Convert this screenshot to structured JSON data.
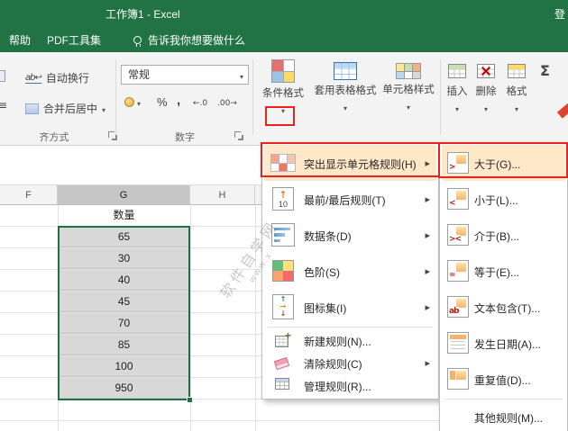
{
  "titlebar": {
    "title": "工作簿1 - Excel",
    "signin_label": "登"
  },
  "menubar": {
    "tabs": [
      {
        "label": "帮助"
      },
      {
        "label": "PDF工具集"
      }
    ],
    "tell_me": "告诉我你想要做什么"
  },
  "ribbon": {
    "wrap_text_label": "自动换行",
    "merge_center_label": "合并后居中",
    "number_format_value": "常规",
    "percent_label": "%",
    "comma_label": ",",
    "increase_decimal_label": "←.0",
    "decrease_decimal_label": ".00→",
    "conditional_formatting_label": "条件格式",
    "format_as_table_label": "套用表格格式",
    "cell_styles_label": "单元格样式",
    "insert_label": "插入",
    "delete_label": "删除",
    "format_label": "格式",
    "autosum_label": "Σ",
    "alignment_group_label": "齐方式",
    "number_group_label": "数字"
  },
  "sheet": {
    "column_headers": [
      "F",
      "G",
      "H"
    ],
    "selected_column": "G",
    "header_cell": "数量",
    "values": [
      "65",
      "30",
      "40",
      "45",
      "70",
      "85",
      "100",
      "950"
    ]
  },
  "cf_menu": {
    "items": [
      {
        "label": "突出显示单元格规则(H)",
        "has_submenu": true,
        "highlighted": true
      },
      {
        "label": "最前/最后规则(T)",
        "has_submenu": true
      },
      {
        "label": "数据条(D)",
        "has_submenu": true
      },
      {
        "label": "色阶(S)",
        "has_submenu": true
      },
      {
        "label": "图标集(I)",
        "has_submenu": true
      },
      {
        "label": "新建规则(N)...",
        "has_submenu": false
      },
      {
        "label": "清除规则(C)",
        "has_submenu": true
      },
      {
        "label": "管理规则(R)...",
        "has_submenu": false
      }
    ]
  },
  "cf_submenu": {
    "items": [
      {
        "label": "大于(G)...",
        "symbol": ">",
        "highlighted": true
      },
      {
        "label": "小于(L)...",
        "symbol": "<"
      },
      {
        "label": "介于(B)...",
        "symbol": "><"
      },
      {
        "label": "等于(E)...",
        "symbol": "="
      },
      {
        "label": "文本包含(T)...",
        "symbol": "ab"
      },
      {
        "label": "发生日期(A)...",
        "symbol": ""
      },
      {
        "label": "重复值(D)...",
        "symbol": ""
      },
      {
        "label": "其他规则(M)...",
        "symbol": ""
      }
    ]
  },
  "icons": {
    "lightbulb_icon": "lightbulb outline",
    "dropdown_caret": "▾",
    "submenu_arrow": "▸",
    "wrap_text_icon": "ab↩",
    "merge_center_icon": "merged-cell",
    "currency_icon": "coin",
    "conditional_formatting_icon": "colored-grid",
    "format_as_table_icon": "blue-table",
    "cell_styles_icon": "colored-cells",
    "insert_icon": "cells-green-row",
    "delete_icon": "cells-red-x",
    "format_icon": "cells-yellow-row",
    "highlight_cells_icon": "grid-red-cells",
    "top_bottom_icon": "arrow-up-10",
    "data_bars_icon": "blue-bars",
    "color_scales_icon": "color-quadrants",
    "icon_sets_icon": "colored-arrows",
    "new_rule_icon": "grid-plus",
    "clear_rules_icon": "pink-eraser",
    "manage_rules_icon": "grid"
  },
  "colors": {
    "excel_green": "#217346",
    "annotation_red": "#e8231d",
    "selection_fill": "#d8d8d8",
    "selection_border": "#1e7145",
    "menu_highlight": "#ffe8c8"
  },
  "watermark": {
    "line1": "软件自学网",
    "line2": "www.x"
  }
}
